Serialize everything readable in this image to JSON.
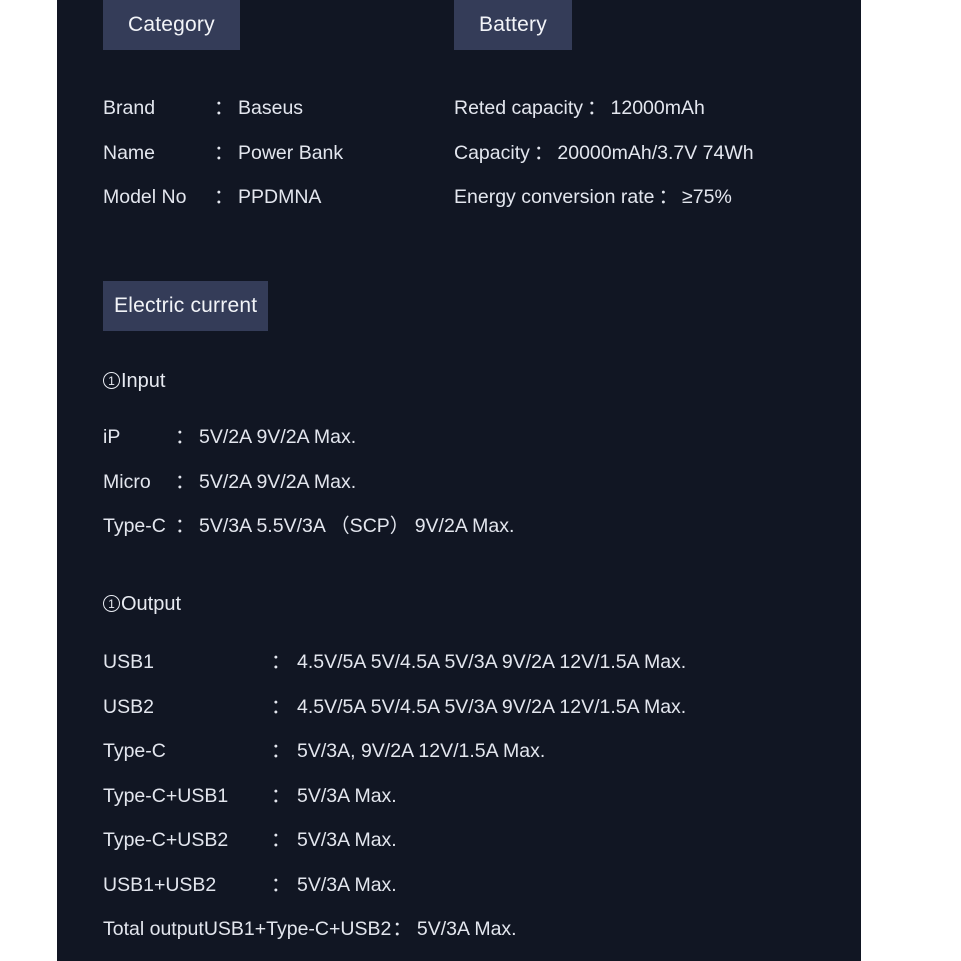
{
  "panel": {
    "background_color": "#111623",
    "text_color": "#e3e6ee",
    "badge_color": "#343c58"
  },
  "category": {
    "badge": "Category",
    "rows": [
      {
        "label": "Brand",
        "colon": "：",
        "value": "Baseus"
      },
      {
        "label": "Name",
        "colon": "：",
        "value": "Power Bank"
      },
      {
        "label": "Model No",
        "colon": "：",
        "value": "PPDMNA"
      }
    ]
  },
  "battery": {
    "badge": "Battery",
    "rows": [
      {
        "label": "Reted capacity",
        "colon": "：",
        "value": "12000mAh"
      },
      {
        "label": "Capacity",
        "colon": "：",
        "value": "20000mAh/3.7V 74Wh"
      },
      {
        "label": "Energy conversion rate",
        "colon": "：",
        "value": "≥75%"
      }
    ]
  },
  "electric_current": {
    "badge": "Electric current",
    "input": {
      "marker": "1",
      "heading": "Input",
      "rows": [
        {
          "label": "iP",
          "colon": "：",
          "value": "5V/2A  9V/2A  Max."
        },
        {
          "label": "Micro",
          "colon": "：",
          "value": "5V/2A   9V/2A  Max."
        },
        {
          "label": "Type-C",
          "colon": "：",
          "value": "5V/3A 5.5V/3A （SCP）  9V/2A Max."
        }
      ]
    },
    "output": {
      "marker": "1",
      "heading": "Output",
      "rows": [
        {
          "label": "USB1",
          "colon": "：",
          "value": "4.5V/5A 5V/4.5A  5V/3A 9V/2A 12V/1.5A Max."
        },
        {
          "label": "USB2",
          "colon": "：",
          "value": "4.5V/5A 5V/4.5A  5V/3A 9V/2A 12V/1.5A Max."
        },
        {
          "label": "Type-C",
          "colon": "：",
          "value": "5V/3A, 9V/2A  12V/1.5A Max."
        },
        {
          "label": "Type-C+USB1",
          "colon": "：",
          "value": "5V/3A Max."
        },
        {
          "label": "Type-C+USB2",
          "colon": "：",
          "value": "5V/3A Max."
        },
        {
          "label": "USB1+USB2",
          "colon": "：",
          "value": "5V/3A Max."
        },
        {
          "label": "Total outputUSB1+Type-C+USB2",
          "colon": "：",
          "value": "5V/3A Max.",
          "wide": true
        }
      ]
    }
  }
}
